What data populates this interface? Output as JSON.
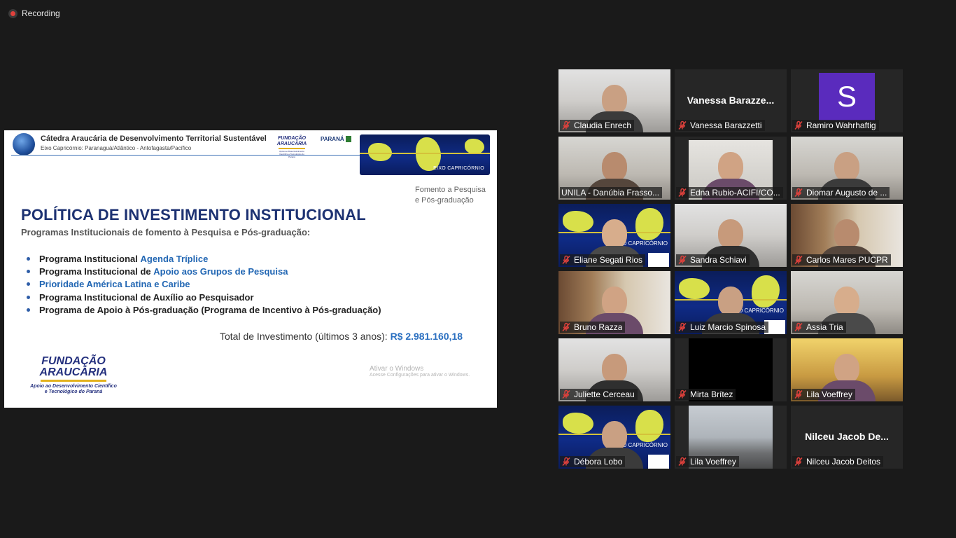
{
  "recording": {
    "label": "Recording"
  },
  "slide": {
    "header_title": "Cátedra Araucária de Desenvolvimento Territorial Sustentável",
    "header_subtitle": "Eixo Capricórnio: Paranaguá/Atlântico - Antofagasta/Pacífico",
    "logo_fundacao_small": [
      "FUNDAÇÃO",
      "ARAUCÁRIA",
      "Apoio ao Desenvolvimento Científico e Tecnológico do Paraná"
    ],
    "logo_parana": "PARANÁ",
    "banner_text": "EIXO CAPRICÓRNIO",
    "tag_line1": "Fomento a Pesquisa",
    "tag_line2": "e Pós-graduação",
    "title": "POLÍTICA DE INVESTIMENTO INSTITUCIONAL",
    "subtitle": "Programas Institucionais de fomento à Pesquisa e Pós-graduação:",
    "bullets": [
      {
        "prefix": "Programa Institucional ",
        "highlight": "Agenda Tríplice"
      },
      {
        "prefix": "Programa Institucional de ",
        "highlight": "Apoio aos Grupos de Pesquisa"
      },
      {
        "prefix": "",
        "highlight": "Prioridade América Latina e Caribe"
      },
      {
        "prefix": "Programa Institucional de Auxílio ao Pesquisador",
        "highlight": ""
      },
      {
        "prefix": "Programa de Apoio à Pós-graduação (Programa de Incentivo à Pós-graduação)",
        "highlight": ""
      }
    ],
    "total_label": "Total de Investimento (últimos 3 anos): ",
    "total_value": "R$ 2.981.160,18",
    "watermark_line1": "Ativar o Windows",
    "watermark_line2": "Acesse Configurações para ativar o Windows.",
    "logo_fundacao_big": [
      "FUNDAÇÃO",
      "ARAUCÁRIA",
      "Apoio ao Desenvolvimento Científico",
      "e Tecnológico do Paraná"
    ]
  },
  "participants": [
    {
      "name": "Claudia Enrech",
      "video": "office",
      "muted": true
    },
    {
      "name": "Vanessa Barazzetti",
      "display": "Vanessa Barazze...",
      "video": "none",
      "muted": true
    },
    {
      "name": "Ramiro Wahrhaftig",
      "avatar": "S",
      "video": "avatar",
      "muted": true
    },
    {
      "name": "UNILA - Danúbia Frasso...",
      "video": "room",
      "muted": false,
      "active": true
    },
    {
      "name": "Edna Rubio-ACIFI/CO...",
      "video": "edna",
      "muted": true
    },
    {
      "name": "Diomar Augusto de ...",
      "video": "room",
      "muted": true
    },
    {
      "name": "Eliane Segati Rios",
      "video": "eixo",
      "muted": true
    },
    {
      "name": "Sandra Schiavi",
      "video": "office",
      "muted": true
    },
    {
      "name": "Carlos Mares PUCPR",
      "video": "books",
      "muted": true
    },
    {
      "name": "Bruno Razza",
      "video": "books",
      "muted": true
    },
    {
      "name": "Luiz Marcio Spinosa",
      "video": "eixo",
      "muted": true
    },
    {
      "name": "Assia Tria",
      "video": "room",
      "muted": true
    },
    {
      "name": "Juliette Cerceau",
      "video": "office",
      "muted": true
    },
    {
      "name": "Mirta Brítez",
      "video": "black",
      "muted": true
    },
    {
      "name": "Lila Voeffrey",
      "video": "wood",
      "muted": true
    },
    {
      "name": "Débora Lobo",
      "video": "eixo",
      "muted": true
    },
    {
      "name": "Lila Voeffrey",
      "video": "city",
      "muted": true
    },
    {
      "name": "Nilceu Jacob Deitos",
      "display": "Nilceu Jacob De...",
      "video": "none",
      "muted": true
    }
  ],
  "eixo_label": "EIXO CAPRICÓRNIO",
  "colors": {
    "active_speaker": "#e9e07a",
    "muted_icon": "#e0413c",
    "avatar_bg": "#5a2bbd"
  }
}
